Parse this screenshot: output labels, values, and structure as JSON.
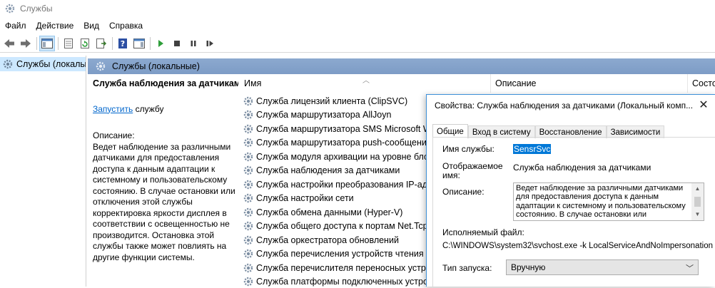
{
  "window": {
    "title": "Службы"
  },
  "menu": [
    "Файл",
    "Действие",
    "Вид",
    "Справка"
  ],
  "tree": {
    "item": "Службы (локалы"
  },
  "panel": {
    "header": "Службы (локальные)"
  },
  "left": {
    "service_title": "Служба наблюдения за датчиками",
    "start_link": "Запустить",
    "start_suffix": " службу",
    "desc_label": "Описание:",
    "desc_text": "Ведет наблюдение за различными датчиками для предоставления доступа к данным адаптации к системному и пользовательскому состоянию.  В случае остановки или отключения этой службы корректировка яркости дисплея в соответствии с освещенностью не производится. Остановка этой службы также может повлиять на другие функции системы."
  },
  "columns": {
    "name": "Имя",
    "description": "Описание",
    "status": "Состо"
  },
  "rows": [
    "Служба лицензий клиента (ClipSVC)",
    "Служба маршрутизатора AllJoyn",
    "Служба маршрутизатора SMS Microsoft Wi",
    "Служба маршрутизатора push-сообщений",
    "Служба модуля архивации на уровне блоко",
    "Служба наблюдения за датчиками",
    "Служба настройки преобразования IP-адре",
    "Служба настройки сети",
    "Служба обмена данными (Hyper-V)",
    "Служба общего доступа к портам Net.Tcp",
    "Служба оркестратора обновлений",
    "Служба перечисления устройств чтения см",
    "Служба перечислителя переносных устрой",
    "Служба платформы подключенных устрой"
  ],
  "dialog": {
    "title": "Свойства: Служба наблюдения за датчиками (Локальный комп...",
    "tabs": [
      "Общие",
      "Вход в систему",
      "Восстановление",
      "Зависимости"
    ],
    "service_name_label": "Имя службы:",
    "service_name": "SensrSvc",
    "display_name_label_1": "Отображаемое",
    "display_name_label_2": "имя:",
    "display_name": "Служба наблюдения за датчиками",
    "description_label": "Описание:",
    "description": "Ведет наблюдение за различными датчиками для предоставления доступа к данным адаптации к системному и пользовательскому состоянию.  В случае остановки или",
    "exe_label": "Исполняемый файл:",
    "exe_path": "C:\\WINDOWS\\system32\\svchost.exe -k LocalServiceAndNoImpersonation",
    "startup_label": "Тип запуска:",
    "startup_value": "Вручную"
  }
}
